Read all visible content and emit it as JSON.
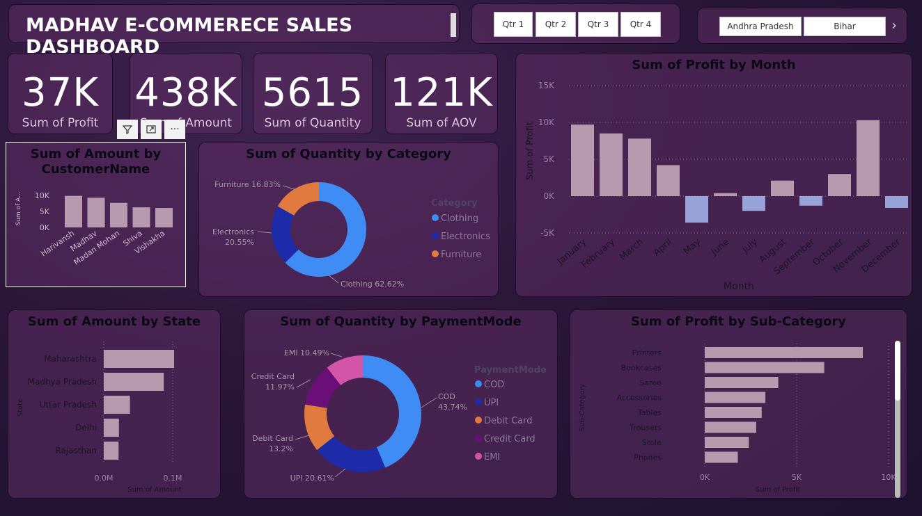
{
  "header": {
    "title": "MADHAV E-COMMERECE SALES DASHBOARD"
  },
  "quarter_slicer": [
    "Qtr 1",
    "Qtr 2",
    "Qtr 3",
    "Qtr 4"
  ],
  "state_slicer": [
    "Andhra Pradesh",
    "Bihar"
  ],
  "kpis": [
    {
      "value": "37K",
      "label": "Sum of Profit"
    },
    {
      "value": "438K",
      "label": "Sum of Amount"
    },
    {
      "value": "5615",
      "label": "Sum of Quantity"
    },
    {
      "value": "121K",
      "label": "Sum of AOV"
    }
  ],
  "colors": {
    "bar": "#b89aaf",
    "negative_bar": "#97a3d8",
    "clothing": "#3f8cf5",
    "electronics": "#1e2ba8",
    "furniture": "#e07a3f",
    "credit_card": "#6a0f78",
    "emi": "#d455a8"
  },
  "chart_data": [
    {
      "type": "bar",
      "title": "Sum of Amount by CustomerName",
      "ylabel": "Sum of A...",
      "categories": [
        "Harivansh",
        "Madhav",
        "Madan Mohan",
        "Shiva",
        "Vishakha"
      ],
      "values": [
        9900,
        9300,
        7700,
        6300,
        6100
      ],
      "ylim": [
        0,
        12000
      ],
      "yticks": [
        "0K",
        "5K",
        "10K"
      ]
    },
    {
      "type": "pie",
      "title": "Sum of Quantity by Category",
      "legend_title": "Category",
      "slices": [
        {
          "name": "Clothing",
          "value": 62.62,
          "label": "Clothing 62.62%",
          "color": "#3f8cf5"
        },
        {
          "name": "Electronics",
          "value": 20.55,
          "label": "Electronics 20.55%",
          "color": "#1e2ba8"
        },
        {
          "name": "Furniture",
          "value": 16.83,
          "label": "Furniture 16.83%",
          "color": "#e07a3f"
        }
      ]
    },
    {
      "type": "bar",
      "title": "Sum of Profit by Month",
      "xlabel": "Month",
      "ylabel": "Sum of Profit",
      "categories": [
        "January",
        "February",
        "March",
        "April",
        "May",
        "June",
        "July",
        "August",
        "September",
        "October",
        "November",
        "December"
      ],
      "values": [
        9700,
        8500,
        7800,
        4200,
        -3600,
        400,
        -2000,
        2100,
        -1300,
        3000,
        10300,
        -1600
      ],
      "ylim": [
        -5000,
        15000
      ],
      "yticks": [
        "-5K",
        "0K",
        "5K",
        "10K",
        "15K"
      ]
    },
    {
      "type": "bar",
      "orientation": "horizontal",
      "title": "Sum of Amount by State",
      "xlabel": "Sum of Amount",
      "ylabel": "State",
      "categories": [
        "Maharashtra",
        "Madhya Pradesh",
        "Uttar Pradesh",
        "Delhi",
        "Rajasthan"
      ],
      "values": [
        102000,
        87000,
        38000,
        22000,
        21500
      ],
      "xticks": [
        "0.0M",
        "0.1M"
      ]
    },
    {
      "type": "pie",
      "title": "Sum of Quantity by PaymentMode",
      "legend_title": "PaymentMode",
      "slices": [
        {
          "name": "COD",
          "value": 43.74,
          "label": "COD 43.74%",
          "color": "#3f8cf5"
        },
        {
          "name": "UPI",
          "value": 20.61,
          "label": "UPI 20.61%",
          "color": "#1e2ba8"
        },
        {
          "name": "Debit Card",
          "value": 13.2,
          "label": "Debit Card 13.2%",
          "color": "#e07a3f"
        },
        {
          "name": "Credit Card",
          "value": 11.97,
          "label": "Credit Card 11.97%",
          "color": "#6a0f78"
        },
        {
          "name": "EMI",
          "value": 10.49,
          "label": "EMI 10.49%",
          "color": "#d455a8"
        }
      ]
    },
    {
      "type": "bar",
      "orientation": "horizontal",
      "title": "Sum of Profit by Sub-Category",
      "xlabel": "Sum of Profit",
      "ylabel": "Sub-Category",
      "categories": [
        "Printers",
        "Bookcases",
        "Saree",
        "Accessories",
        "Tables",
        "Trousers",
        "Stole",
        "Phones"
      ],
      "values": [
        8600,
        6500,
        4000,
        3300,
        3100,
        2800,
        2400,
        1800
      ],
      "xlim": [
        0,
        10000
      ],
      "xticks": [
        "0K",
        "5K",
        "10K"
      ]
    }
  ]
}
